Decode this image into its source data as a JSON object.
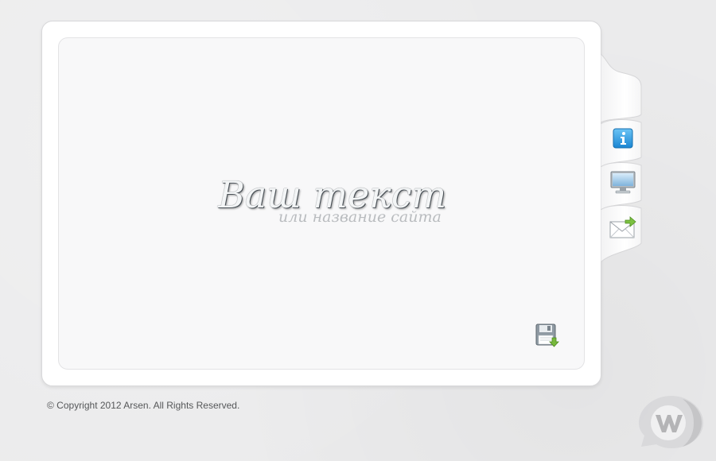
{
  "logo": {
    "title": "Ваш текст",
    "subtitle": "или название сайта"
  },
  "tabs": [
    {
      "name": "info",
      "icon": "info-icon"
    },
    {
      "name": "portfolio",
      "icon": "monitor-icon"
    },
    {
      "name": "contact",
      "icon": "mail-icon"
    }
  ],
  "content": {
    "save_icon": "save-icon"
  },
  "footer": {
    "copyright": "© Copyright 2012 Arsen. All Rights Reserved."
  },
  "watermark": {
    "icon": "w-logo-icon"
  },
  "colors": {
    "background": "#ebebec",
    "panel": "#ffffff",
    "inner_panel": "#f8f8f9",
    "info_blue": "#2a9be2",
    "mail_arrow_green": "#6fb63b"
  }
}
